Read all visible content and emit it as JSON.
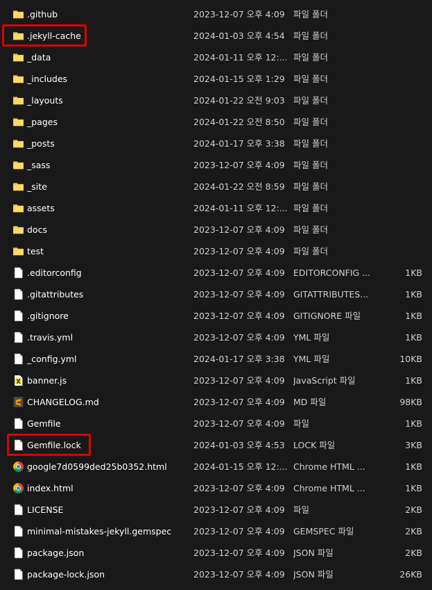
{
  "files": [
    {
      "name": ".github",
      "date": "2023-12-07 오후 4:09",
      "type": "파일 폴더",
      "size": "",
      "icon": "folder-icon"
    },
    {
      "name": ".jekyll-cache",
      "date": "2024-01-03 오후 4:54",
      "type": "파일 폴더",
      "size": "",
      "icon": "folder-icon"
    },
    {
      "name": "_data",
      "date": "2024-01-11 오후 12:...",
      "type": "파일 폴더",
      "size": "",
      "icon": "folder-icon"
    },
    {
      "name": "_includes",
      "date": "2024-01-15 오후 1:29",
      "type": "파일 폴더",
      "size": "",
      "icon": "folder-icon"
    },
    {
      "name": "_layouts",
      "date": "2024-01-22 오전 9:03",
      "type": "파일 폴더",
      "size": "",
      "icon": "folder-icon"
    },
    {
      "name": "_pages",
      "date": "2024-01-22 오전 8:50",
      "type": "파일 폴더",
      "size": "",
      "icon": "folder-icon"
    },
    {
      "name": "_posts",
      "date": "2024-01-17 오후 3:38",
      "type": "파일 폴더",
      "size": "",
      "icon": "folder-icon"
    },
    {
      "name": "_sass",
      "date": "2023-12-07 오후 4:09",
      "type": "파일 폴더",
      "size": "",
      "icon": "folder-icon"
    },
    {
      "name": "_site",
      "date": "2024-01-22 오전 8:59",
      "type": "파일 폴더",
      "size": "",
      "icon": "folder-icon"
    },
    {
      "name": "assets",
      "date": "2024-01-11 오후 12:...",
      "type": "파일 폴더",
      "size": "",
      "icon": "folder-icon"
    },
    {
      "name": "docs",
      "date": "2023-12-07 오후 4:09",
      "type": "파일 폴더",
      "size": "",
      "icon": "folder-icon"
    },
    {
      "name": "test",
      "date": "2023-12-07 오후 4:09",
      "type": "파일 폴더",
      "size": "",
      "icon": "folder-icon"
    },
    {
      "name": ".editorconfig",
      "date": "2023-12-07 오후 4:09",
      "type": "EDITORCONFIG ...",
      "size": "1KB",
      "icon": "file-icon"
    },
    {
      "name": ".gitattributes",
      "date": "2023-12-07 오후 4:09",
      "type": "GITATTRIBUTES...",
      "size": "1KB",
      "icon": "file-icon"
    },
    {
      "name": ".gitignore",
      "date": "2023-12-07 오후 4:09",
      "type": "GITIGNORE 파일",
      "size": "1KB",
      "icon": "file-icon"
    },
    {
      "name": ".travis.yml",
      "date": "2023-12-07 오후 4:09",
      "type": "YML 파일",
      "size": "1KB",
      "icon": "file-icon"
    },
    {
      "name": "_config.yml",
      "date": "2024-01-17 오후 3:38",
      "type": "YML 파일",
      "size": "10KB",
      "icon": "file-icon"
    },
    {
      "name": "banner.js",
      "date": "2023-12-07 오후 4:09",
      "type": "JavaScript 파일",
      "size": "1KB",
      "icon": "javascript-file-icon"
    },
    {
      "name": "CHANGELOG.md",
      "date": "2023-12-07 오후 4:09",
      "type": "MD 파일",
      "size": "98KB",
      "icon": "sublime-text-file-icon"
    },
    {
      "name": "Gemfile",
      "date": "2023-12-07 오후 4:09",
      "type": "파일",
      "size": "1KB",
      "icon": "file-icon"
    },
    {
      "name": "Gemfile.lock",
      "date": "2024-01-03 오후 4:53",
      "type": "LOCK 파일",
      "size": "3KB",
      "icon": "file-icon"
    },
    {
      "name": "google7d0599ded25b0352.html",
      "date": "2024-01-15 오후 12:...",
      "type": "Chrome HTML ...",
      "size": "1KB",
      "icon": "chrome-icon"
    },
    {
      "name": "index.html",
      "date": "2023-12-07 오후 4:09",
      "type": "Chrome HTML ...",
      "size": "1KB",
      "icon": "chrome-icon"
    },
    {
      "name": "LICENSE",
      "date": "2023-12-07 오후 4:09",
      "type": "파일",
      "size": "2KB",
      "icon": "file-icon"
    },
    {
      "name": "minimal-mistakes-jekyll.gemspec",
      "date": "2023-12-07 오후 4:09",
      "type": "GEMSPEC 파일",
      "size": "2KB",
      "icon": "file-icon"
    },
    {
      "name": "package.json",
      "date": "2023-12-07 오후 4:09",
      "type": "JSON 파일",
      "size": "2KB",
      "icon": "file-icon"
    },
    {
      "name": "package-lock.json",
      "date": "2023-12-07 오후 4:09",
      "type": "JSON 파일",
      "size": "26KB",
      "icon": "file-icon"
    }
  ],
  "highlighted": [
    ".jekyll-cache",
    "Gemfile.lock"
  ],
  "colors": {
    "background": "#191919",
    "folder": "#f4c542",
    "highlight_border": "#e00000"
  }
}
